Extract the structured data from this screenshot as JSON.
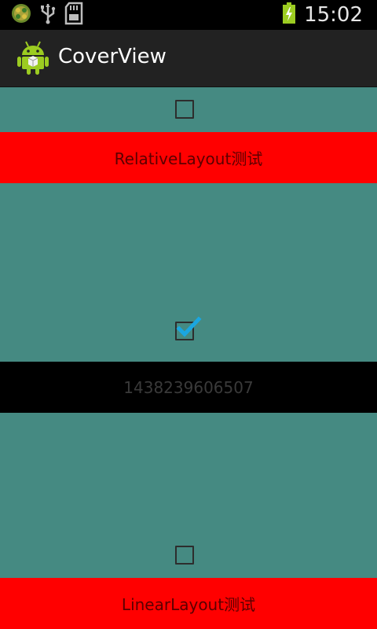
{
  "status_bar": {
    "time": "15:02",
    "icons": [
      "app-notification-icon",
      "usb-icon",
      "sd-card-icon",
      "battery-charging-icon"
    ]
  },
  "action_bar": {
    "title": "CoverView",
    "logo_icon": "android-logo-icon"
  },
  "content": {
    "checkbox_top": {
      "checked": false
    },
    "relative_layout_label": "RelativeLayout测试",
    "checkbox_middle": {
      "checked": true
    },
    "timestamp_text": "1438239606507",
    "checkbox_bottom": {
      "checked": false
    },
    "linear_layout_label": "LinearLayout测试"
  },
  "colors": {
    "background": "#458a82",
    "red_bar": "#ff0000",
    "black_bar": "#000000",
    "check_accent": "#1aa6e0"
  }
}
